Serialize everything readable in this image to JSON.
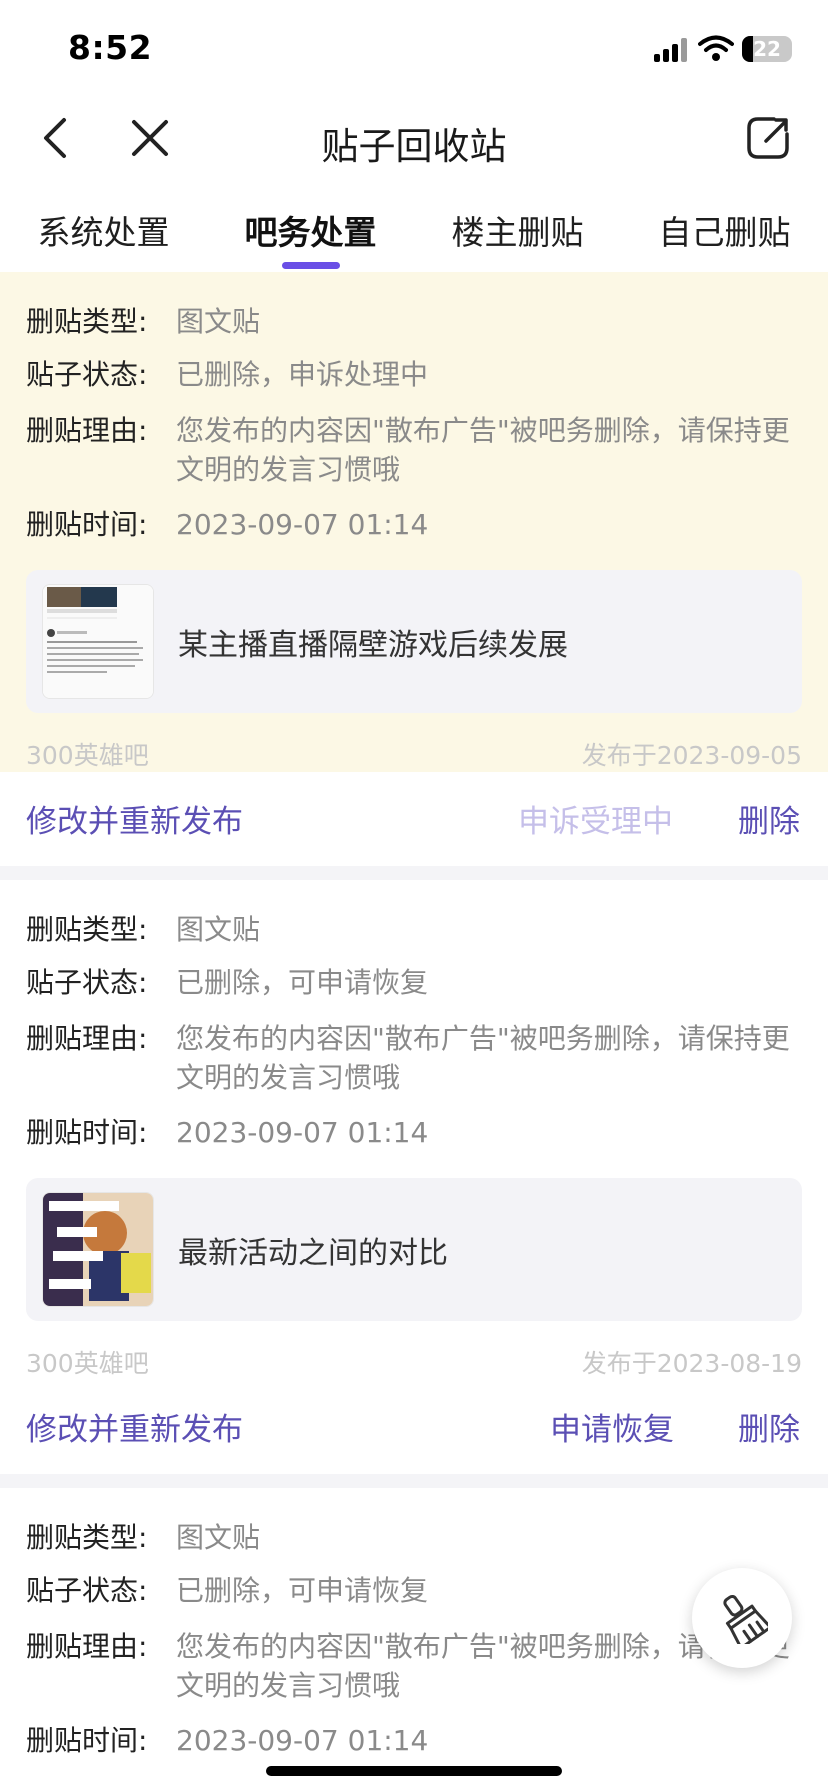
{
  "status_bar": {
    "time": "8:52",
    "battery_level": "22",
    "battery_fraction": 0.22
  },
  "nav": {
    "title": "贴子回收站",
    "back_icon": "chevron-left-icon",
    "close_icon": "close-icon",
    "share_icon": "share-icon"
  },
  "tabs": [
    {
      "label": "系统处置",
      "active": false
    },
    {
      "label": "吧务处置",
      "active": true
    },
    {
      "label": "楼主删贴",
      "active": false
    },
    {
      "label": "自己删贴",
      "active": false
    }
  ],
  "accent_color": "#6a4fe6",
  "labels": {
    "type": "删贴类型:",
    "status": "贴子状态:",
    "reason": "删贴理由:",
    "time": "删贴时间:"
  },
  "cards": [
    {
      "highlighted": true,
      "type": "图文贴",
      "status": "已删除，申诉处理中",
      "reason": "您发布的内容因\"散布广告\"被吧务删除，请保持更文明的发言习惯哦",
      "time": "2023-09-07 01:14",
      "post_title": "某主播直播隔壁游戏后续发展",
      "forum": "300英雄吧",
      "published": "发布于2023-09-05",
      "actions": {
        "edit": "修改并重新发布",
        "middle": "申诉受理中",
        "delete": "删除"
      }
    },
    {
      "highlighted": false,
      "type": "图文贴",
      "status": "已删除，可申请恢复",
      "reason": "您发布的内容因\"散布广告\"被吧务删除，请保持更文明的发言习惯哦",
      "time": "2023-09-07 01:14",
      "post_title": "最新活动之间的对比",
      "forum": "300英雄吧",
      "published": "发布于2023-08-19",
      "actions": {
        "edit": "修改并重新发布",
        "middle": "申请恢复",
        "delete": "删除"
      }
    },
    {
      "highlighted": false,
      "type": "图文贴",
      "status": "已删除，可申请恢复",
      "reason": "您发布的内容因\"散布广告\"被吧务删除，请保持更文明的发言习惯哦",
      "time": "2023-09-07 01:14"
    }
  ],
  "fab": {
    "icon": "broom-icon"
  }
}
